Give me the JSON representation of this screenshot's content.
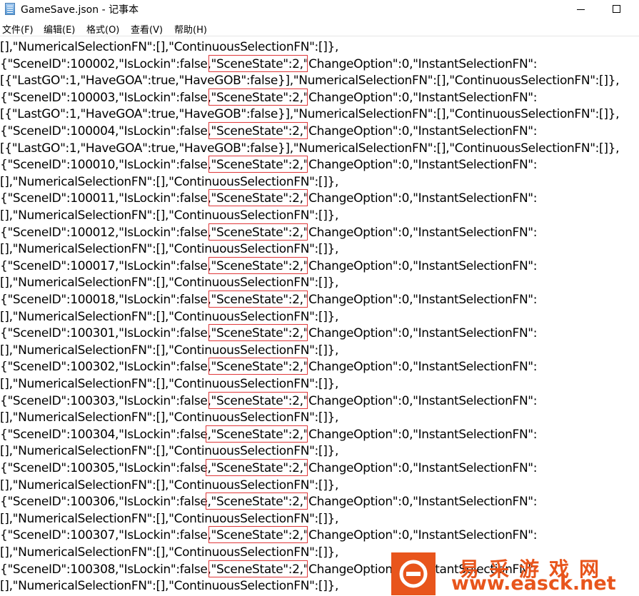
{
  "window": {
    "title": "GameSave.json - 记事本"
  },
  "menu": [
    {
      "label": "文件(F)"
    },
    {
      "label": "编辑(E)"
    },
    {
      "label": "格式(O)"
    },
    {
      "label": "查看(V)"
    },
    {
      "label": "帮助(H)"
    }
  ],
  "editor": {
    "lines": [
      "[],\"NumericalSelectionFN\":[],\"ContinuousSelectionFN\":[]},",
      "{\"SceneID\":100002,\"IsLockin\":false,\"SceneState\":2,\"ChangeOption\":0,\"InstantSelectionFN\":",
      "[{\"LastGO\":1,\"HaveGOA\":true,\"HaveGOB\":false}],\"NumericalSelectionFN\":[],\"ContinuousSelectionFN\":[]},",
      "{\"SceneID\":100003,\"IsLockin\":false,\"SceneState\":2,\"ChangeOption\":0,\"InstantSelectionFN\":",
      "[{\"LastGO\":1,\"HaveGOA\":true,\"HaveGOB\":false}],\"NumericalSelectionFN\":[],\"ContinuousSelectionFN\":[]},",
      "{\"SceneID\":100004,\"IsLockin\":false,\"SceneState\":2,\"ChangeOption\":0,\"InstantSelectionFN\":",
      "[{\"LastGO\":1,\"HaveGOA\":true,\"HaveGOB\":false}],\"NumericalSelectionFN\":[],\"ContinuousSelectionFN\":[]},",
      "{\"SceneID\":100010,\"IsLockin\":false,\"SceneState\":2,\"ChangeOption\":0,\"InstantSelectionFN\":",
      "[],\"NumericalSelectionFN\":[],\"ContinuousSelectionFN\":[]},",
      "{\"SceneID\":100011,\"IsLockin\":false,\"SceneState\":2,\"ChangeOption\":0,\"InstantSelectionFN\":",
      "[],\"NumericalSelectionFN\":[],\"ContinuousSelectionFN\":[]},",
      "{\"SceneID\":100012,\"IsLockin\":false,\"SceneState\":2,\"ChangeOption\":0,\"InstantSelectionFN\":",
      "[],\"NumericalSelectionFN\":[],\"ContinuousSelectionFN\":[]},",
      "{\"SceneID\":100017,\"IsLockin\":false,\"SceneState\":2,\"ChangeOption\":0,\"InstantSelectionFN\":",
      "[],\"NumericalSelectionFN\":[],\"ContinuousSelectionFN\":[]},",
      "{\"SceneID\":100018,\"IsLockin\":false,\"SceneState\":2,\"ChangeOption\":0,\"InstantSelectionFN\":",
      "[],\"NumericalSelectionFN\":[],\"ContinuousSelectionFN\":[]},",
      "{\"SceneID\":100301,\"IsLockin\":false,\"SceneState\":2,\"ChangeOption\":0,\"InstantSelectionFN\":",
      "[],\"NumericalSelectionFN\":[],\"ContinuousSelectionFN\":[]},",
      "{\"SceneID\":100302,\"IsLockin\":false,\"SceneState\":2,\"ChangeOption\":0,\"InstantSelectionFN\":",
      "[],\"NumericalSelectionFN\":[],\"ContinuousSelectionFN\":[]},",
      "{\"SceneID\":100303,\"IsLockin\":false,\"SceneState\":2,\"ChangeOption\":0,\"InstantSelectionFN\":",
      "[],\"NumericalSelectionFN\":[],\"ContinuousSelectionFN\":[]},",
      "{\"SceneID\":100304,\"IsLockin\":false,\"SceneState\":2,\"ChangeOption\":0,\"InstantSelectionFN\":",
      "[],\"NumericalSelectionFN\":[],\"ContinuousSelectionFN\":[]},",
      "{\"SceneID\":100305,\"IsLockin\":false,\"SceneState\":2,\"ChangeOption\":0,\"InstantSelectionFN\":",
      "[],\"NumericalSelectionFN\":[],\"ContinuousSelectionFN\":[]},",
      "{\"SceneID\":100306,\"IsLockin\":false,\"SceneState\":2,\"ChangeOption\":0,\"InstantSelectionFN\":",
      "[],\"NumericalSelectionFN\":[],\"ContinuousSelectionFN\":[]},",
      "{\"SceneID\":100307,\"IsLockin\":false,\"SceneState\":2,\"ChangeOption\":0,\"InstantSelectionFN\":",
      "[],\"NumericalSelectionFN\":[],\"ContinuousSelectionFN\":[]},",
      "{\"SceneID\":100308,\"IsLockin\":false,\"SceneState\":2,\"ChangeOption\":0,\"InstantSelectionFN\":",
      "[],\"NumericalSelectionFN\":[],\"ContinuousSelectionFN\":[]},"
    ]
  },
  "watermark": {
    "site_name": "易采游戏网",
    "url": "www.easck.net"
  },
  "colors": {
    "highlight": "#e0383a",
    "watermark": "#e8551c"
  }
}
